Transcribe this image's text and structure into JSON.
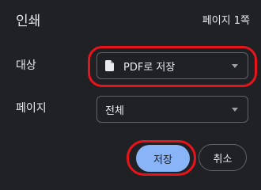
{
  "dialog": {
    "title": "인쇄",
    "page_count": "페이지 1쪽"
  },
  "destination": {
    "label": "대상",
    "value": "PDF로 저장",
    "icon": "file-icon"
  },
  "pages": {
    "label": "페이지",
    "value": "전체"
  },
  "buttons": {
    "save": "저장",
    "cancel": "취소"
  },
  "colors": {
    "background": "#202124",
    "text": "#e8eaed",
    "border": "#5f6368",
    "primary_button": "#8ab4f8",
    "highlight": "#e8141c"
  }
}
